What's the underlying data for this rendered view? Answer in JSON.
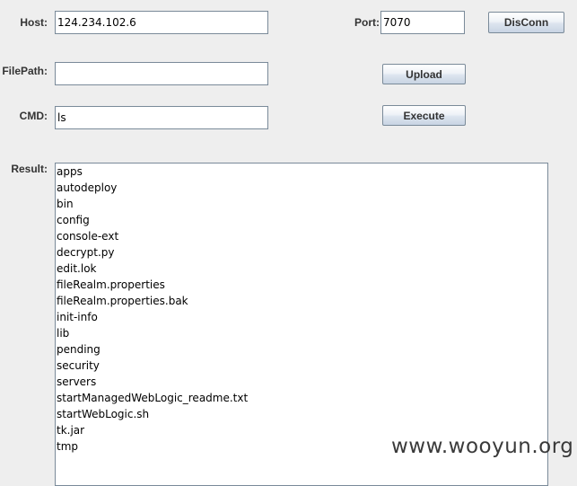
{
  "host": {
    "label": "Host:",
    "value": "124.234.102.6"
  },
  "port": {
    "label": "Port:",
    "value": "7070"
  },
  "disconnect_button": "DisConn",
  "filepath": {
    "label": "FilePath:",
    "value": ""
  },
  "upload_button": "Upload",
  "cmd": {
    "label": "CMD:",
    "value": "ls"
  },
  "execute_button": "Execute",
  "result": {
    "label": "Result:",
    "lines": [
      "apps",
      "autodeploy",
      "bin",
      "config",
      "console-ext",
      "decrypt.py",
      "edit.lok",
      "fileRealm.properties",
      "fileRealm.properties.bak",
      "init-info",
      "lib",
      "pending",
      "security",
      "servers",
      "startManagedWebLogic_readme.txt",
      "startWebLogic.sh",
      "tk.jar",
      "tmp"
    ]
  },
  "watermark": "www.wooyun.org"
}
